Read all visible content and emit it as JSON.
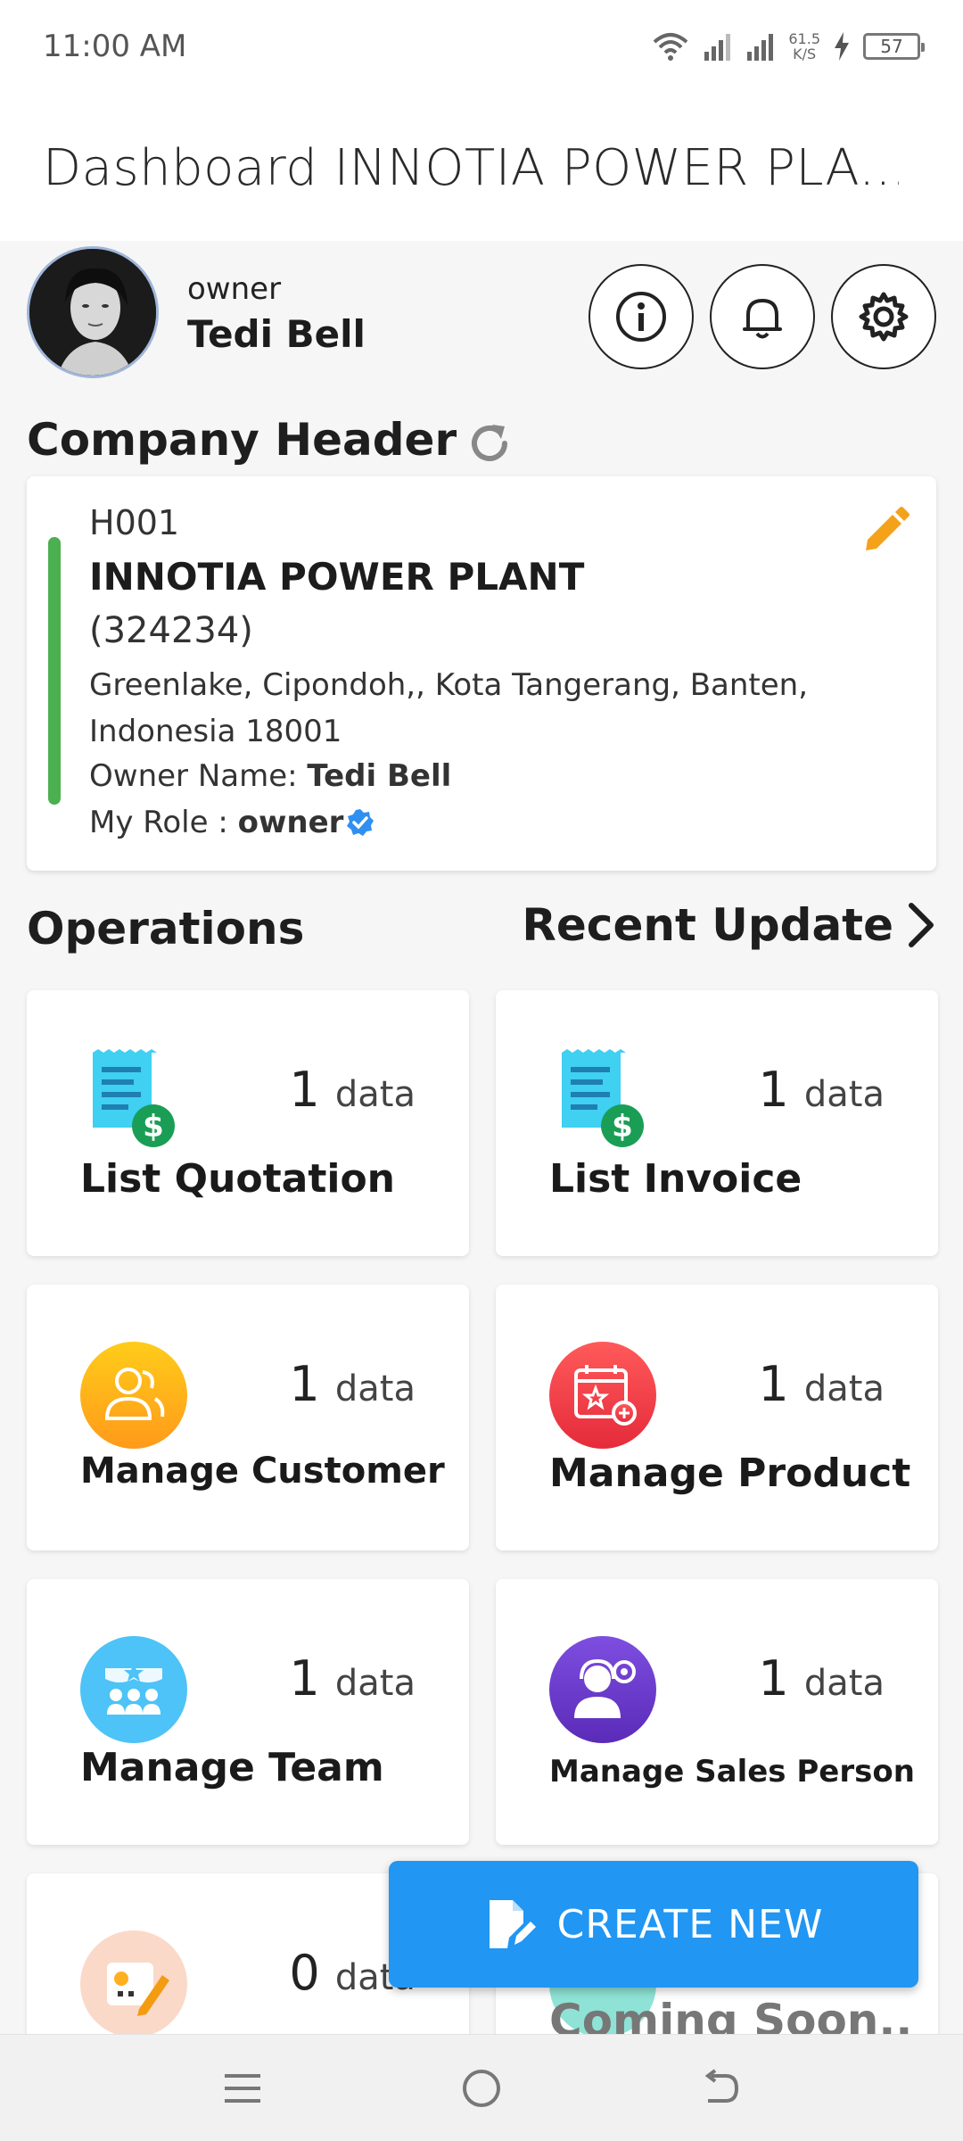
{
  "status_bar": {
    "time": "11:00 AM",
    "net_speed": "61.5",
    "net_unit": "K/S",
    "battery": "57"
  },
  "header": {
    "title": "Dashboard INNOTIA POWER PLA..."
  },
  "profile": {
    "role": "owner",
    "name": "Tedi Bell"
  },
  "company_section": {
    "title": "Company Header"
  },
  "company": {
    "code": "H001",
    "name": "INNOTIA POWER PLANT",
    "number": "(324234)",
    "address_line1": "Greenlake, Cipondoh,, Kota Tangerang, Banten,",
    "address_line2": "Indonesia 18001",
    "owner_label": "Owner Name: ",
    "owner_value": "Tedi Bell",
    "role_label": "My Role : ",
    "role_value": "owner"
  },
  "operations": {
    "title": "Operations",
    "recent_update": "Recent Update"
  },
  "tiles": [
    {
      "label": "List Quotation",
      "count": "1",
      "unit": "data",
      "icon": "quotation-icon"
    },
    {
      "label": "List Invoice",
      "count": "1",
      "unit": "data",
      "icon": "invoice-icon"
    },
    {
      "label": "Manage Customer",
      "count": "1",
      "unit": "data",
      "icon": "customer-icon"
    },
    {
      "label": "Manage Product",
      "count": "1",
      "unit": "data",
      "icon": "product-icon"
    },
    {
      "label": "Manage Team",
      "count": "1",
      "unit": "data",
      "icon": "team-icon"
    },
    {
      "label": "Manage Sales Person",
      "count": "1",
      "unit": "data",
      "icon": "sales-person-icon"
    },
    {
      "label": "",
      "count": "0",
      "unit": "data",
      "icon": "notes-icon"
    },
    {
      "label": "Coming Soon..",
      "count": "",
      "unit": "",
      "icon": "coming-soon-icon"
    }
  ],
  "fab": {
    "label": "CREATE NEW"
  },
  "colors": {
    "accent": "#2196f3",
    "card_bar": "#4caf50",
    "edit": "#f5a21b"
  }
}
